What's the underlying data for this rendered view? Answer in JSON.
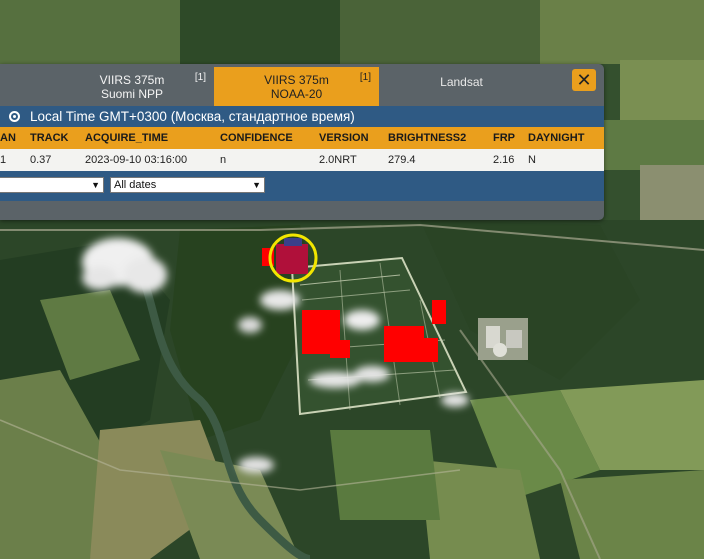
{
  "tabs": [
    {
      "label_line1": "VIIRS 375m",
      "label_line2": "Suomi NPP",
      "count": "[1]",
      "active": false
    },
    {
      "label_line1": "VIIRS 375m",
      "label_line2": "NOAA-20",
      "count": "[1]",
      "active": true
    },
    {
      "label_line1": "Landsat",
      "label_line2": "",
      "count": "",
      "active": false
    }
  ],
  "close_icon": "close-x-icon",
  "timezone": {
    "label": "Local Time GMT+0300 (Москва, стандартное время)"
  },
  "table": {
    "columns": [
      "AN",
      "TRACK",
      "ACQUIRE_TIME",
      "CONFIDENCE",
      "VERSION",
      "BRIGHTNESS2",
      "FRP",
      "DAYNIGHT"
    ],
    "rows": [
      [
        "1",
        "0.37",
        "2023-09-10 03:16:00",
        "n",
        "2.0NRT",
        "279.4",
        "2.16",
        "N"
      ]
    ]
  },
  "filters": {
    "first_select": "",
    "dates_select": "All dates"
  },
  "colors": {
    "accent": "#ea9f1d",
    "header_blue": "#2f5a84",
    "fire_red": "#ff0000",
    "highlight_ring": "#f2e600",
    "selected_pixel": "#b0103a"
  }
}
